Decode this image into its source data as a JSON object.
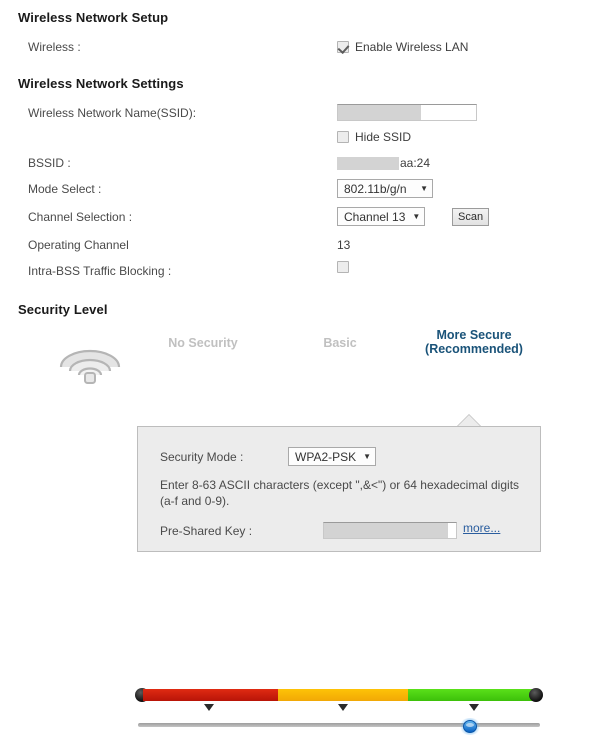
{
  "sections": {
    "setup_heading": "Wireless Network Setup",
    "settings_heading": "Wireless Network Settings",
    "security_heading": "Security Level"
  },
  "setup": {
    "wireless_label": "Wireless :",
    "enable_wireless_lan_label": "Enable Wireless LAN",
    "enable_wireless_lan_checked": true
  },
  "settings": {
    "ssid_label": "Wireless Network Name(SSID):",
    "ssid_value": "",
    "hide_ssid_label": "Hide SSID",
    "hide_ssid_checked": false,
    "bssid_label": "BSSID :",
    "bssid_value_tail": "aa:24",
    "mode_label": "Mode Select :",
    "mode_value": "802.11b/g/n",
    "channel_label": "Channel Selection :",
    "channel_value": "Channel 13",
    "scan_button": "Scan",
    "operating_channel_label": "Operating Channel",
    "operating_channel_value": "13",
    "intra_bss_label": "Intra-BSS Traffic Blocking :",
    "intra_bss_checked": false
  },
  "security_level": {
    "levels": [
      {
        "label": "No Security",
        "active": false,
        "color": "#c0c0c0"
      },
      {
        "label": "Basic",
        "active": false,
        "color": "#c0c0c0"
      },
      {
        "label": "More Secure\n(Recommended)",
        "active": true,
        "color": "#1a5379"
      }
    ],
    "level_line1": "More Secure",
    "level_line2": "(Recommended)",
    "selected_index": 2,
    "bar_colors": {
      "no_security": "#c91a0c",
      "basic": "#f5b30c",
      "more_secure": "#44cc11",
      "cap": "#101010",
      "handle": "#0b63c4"
    },
    "icon": "wifi-signal-icon"
  },
  "security_panel": {
    "security_mode_label": "Security Mode :",
    "security_mode_value": "WPA2-PSK",
    "hint_text": "Enter 8-63 ASCII characters (except \",&<\") or 64 hexadecimal digits (a-f and 0-9).",
    "psk_label": "Pre-Shared Key :",
    "psk_value": "",
    "more_link": "more..."
  },
  "icons": {
    "caret": "▼"
  }
}
